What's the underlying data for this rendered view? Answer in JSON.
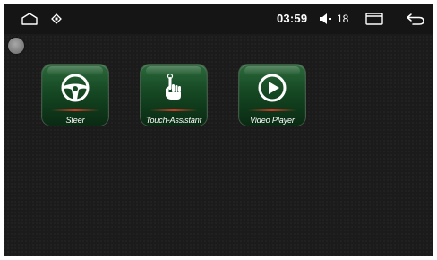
{
  "status_bar": {
    "time": "03:59",
    "volume_level": "18",
    "icons": [
      "home-icon",
      "notification-icon",
      "volume-icon",
      "recent-apps-icon",
      "back-icon"
    ]
  },
  "apps": [
    {
      "label": "Steer",
      "icon": "steering-wheel-icon"
    },
    {
      "label": "Touch-Assistant",
      "icon": "touch-hand-icon"
    },
    {
      "label": "Video Player",
      "icon": "play-circle-icon"
    }
  ],
  "colors": {
    "background": "#1b1b1b",
    "app_tile": "#184c26",
    "accent_red": "#d03a2a",
    "text": "#ffffff"
  }
}
